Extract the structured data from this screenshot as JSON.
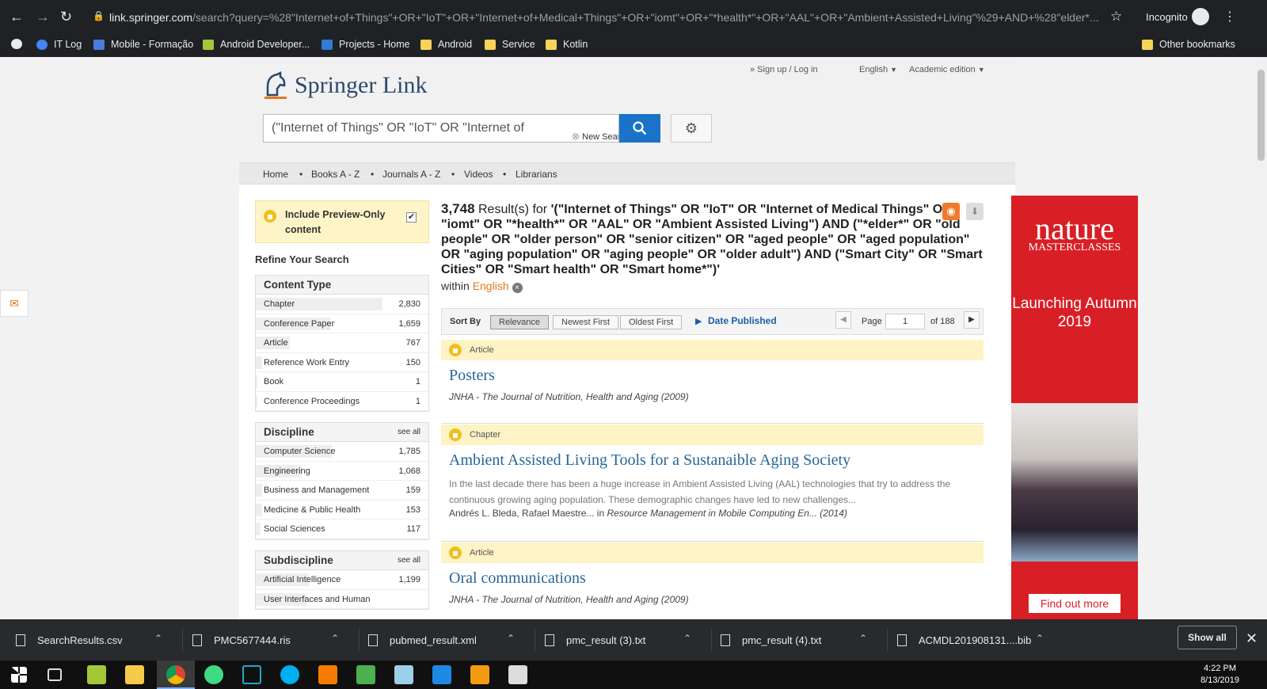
{
  "browser": {
    "url_host": "link.springer.com",
    "url_path": "/search?query=%28\"Internet+of+Things\"+OR+\"IoT\"+OR+\"Internet+of+Medical+Things\"+OR+\"iomt\"+OR+\"*health*\"+OR+\"AAL\"+OR+\"Ambient+Assisted+Living\"%29+AND+%28\"elder*...",
    "incognito_label": "Incognito",
    "bookmarks": [
      "IT Log",
      "Mobile - Formação",
      "Android Developer...",
      "Projects - Home",
      "Android",
      "Service",
      "Kotlin"
    ],
    "other_bookmarks": "Other bookmarks"
  },
  "header": {
    "brand": "Springer",
    "brand_link": "Link",
    "signup": "» Sign up / Log in",
    "language": "English",
    "edition": "Academic edition",
    "search_value": "(\"Internet of Things\" OR \"IoT\" OR \"Internet of",
    "new_search": "New Search"
  },
  "nav": [
    "Home",
    "Books A - Z",
    "Journals A - Z",
    "Videos",
    "Librarians"
  ],
  "sidebar": {
    "preview_label": "Include Preview-Only content",
    "refine": "Refine Your Search",
    "content_type": {
      "title": "Content Type",
      "items": [
        {
          "label": "Chapter",
          "count": "2,830",
          "fraction": 1.0
        },
        {
          "label": "Conference Paper",
          "count": "1,659",
          "fraction": 0.59
        },
        {
          "label": "Article",
          "count": "767",
          "fraction": 0.27
        },
        {
          "label": "Reference Work Entry",
          "count": "150",
          "fraction": 0.05
        },
        {
          "label": "Book",
          "count": "1",
          "fraction": 0.01
        },
        {
          "label": "Conference Proceedings",
          "count": "1",
          "fraction": 0.01
        }
      ]
    },
    "discipline": {
      "title": "Discipline",
      "see_all": "see all",
      "items": [
        {
          "label": "Computer Science",
          "count": "1,785",
          "fraction": 0.6
        },
        {
          "label": "Engineering",
          "count": "1,068",
          "fraction": 0.36
        },
        {
          "label": "Business and Management",
          "count": "159",
          "fraction": 0.05
        },
        {
          "label": "Medicine & Public Health",
          "count": "153",
          "fraction": 0.05
        },
        {
          "label": "Social Sciences",
          "count": "117",
          "fraction": 0.04
        }
      ]
    },
    "subdiscipline": {
      "title": "Subdiscipline",
      "see_all": "see all",
      "items": [
        {
          "label": "Artificial Intelligence",
          "count": "1,199",
          "fraction": 0.42
        },
        {
          "label": "User Interfaces and Human",
          "count": "",
          "fraction": 0.4
        }
      ]
    }
  },
  "results": {
    "count": "3,748",
    "results_for": "Result(s) for",
    "query": "'(\"Internet of Things\" OR \"IoT\" OR \"Internet of Medical Things\" OR \"iomt\" OR \"*health*\" OR \"AAL\" OR \"Ambient Assisted Living\") AND (\"*elder*\" OR \"old people\" OR \"older person\" OR \"senior citizen\" OR \"aged people\" OR \"aged population\" OR \"aging population\" OR \"aging people\" OR \"older adult\") AND (\"Smart City\" OR \"Smart Cities\" OR \"Smart health\" OR \"Smart home*\")'",
    "within": "within",
    "within_lang": "English",
    "sort_by": "Sort By",
    "sort_options": [
      "Relevance",
      "Newest First",
      "Oldest First"
    ],
    "date_published": "Date Published",
    "page_label": "Page",
    "page_value": "1",
    "page_of": "of 188",
    "items": [
      {
        "type": "Article",
        "title": "Posters",
        "meta": "JNHA - The Journal of Nutrition, Health and Aging (2009)"
      },
      {
        "type": "Chapter",
        "title": "Ambient Assisted Living Tools for a Sustanaible Aging Society",
        "snippet": "In the last decade there has been a huge increase in Ambient Assisted Living (AAL) technologies that try to address the continuous growing aging population. These demographic changes have led to new challenges...",
        "authors": "Andrés L. Bleda, Rafael Maestre...",
        "in_word": "in",
        "source": "Resource Management in Mobile Computing En... (2014)"
      },
      {
        "type": "Article",
        "title": "Oral communications",
        "meta": "JNHA - The Journal of Nutrition, Health and Aging (2009)"
      }
    ]
  },
  "ad": {
    "brand": "nature",
    "sub": "MASTERCLASSES",
    "headline": "Launching Autumn 2019",
    "cta": "Find out more"
  },
  "downloads": {
    "files": [
      "SearchResults.csv",
      "PMC5677444.ris",
      "pubmed_result.xml",
      "pmc_result (3).txt",
      "pmc_result (4).txt",
      "ACMDL201908131....bib"
    ],
    "show_all": "Show all"
  },
  "taskbar": {
    "time": "4:22 PM",
    "date": "8/13/2019"
  }
}
